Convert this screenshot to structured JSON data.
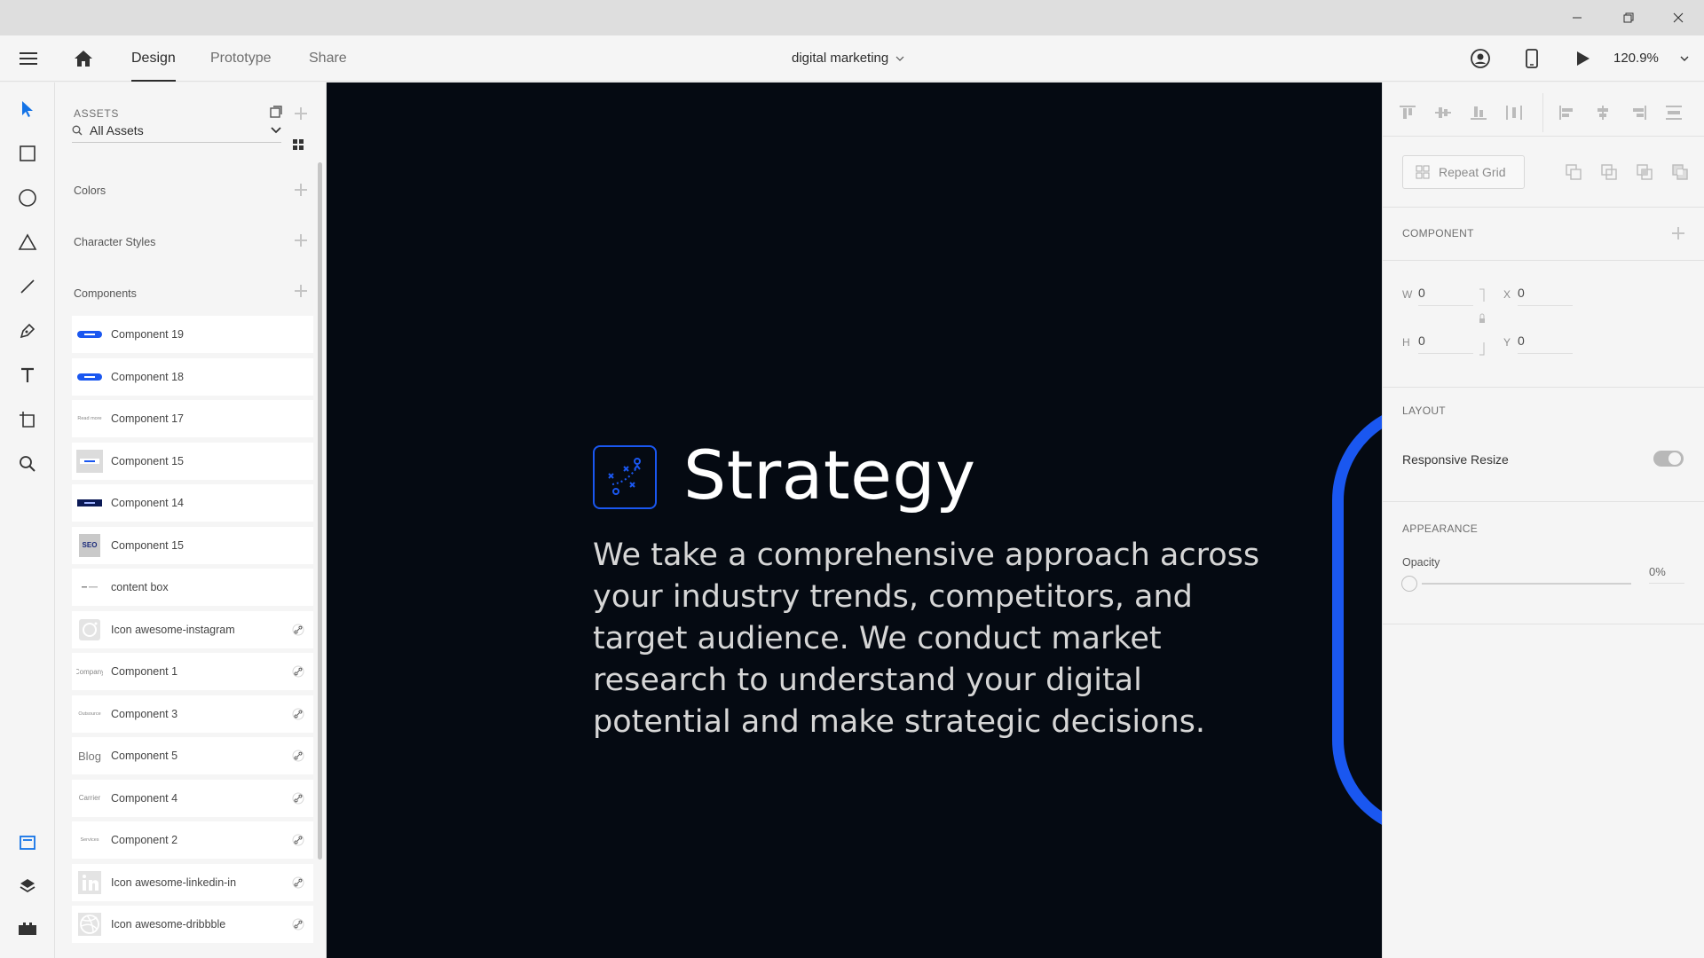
{
  "app": {
    "tabs": [
      {
        "label": "Design",
        "active": true
      },
      {
        "label": "Prototype",
        "active": false
      },
      {
        "label": "Share",
        "active": false
      }
    ],
    "document_title": "digital marketing",
    "zoom": "120.9%"
  },
  "toolbar": {
    "tools": [
      "select-tool",
      "rectangle-tool",
      "ellipse-tool",
      "polygon-tool",
      "line-tool",
      "pen-tool",
      "text-tool",
      "artboard-tool",
      "zoom-tool"
    ],
    "bottom": [
      "assets-panel",
      "layers-panel",
      "plugins-panel"
    ]
  },
  "assets": {
    "header": "ASSETS",
    "filter_value": "All Assets",
    "sections": {
      "colors": "Colors",
      "character_styles": "Character Styles",
      "components": "Components"
    },
    "components": [
      {
        "label": "Component 19",
        "thumb": "blue-pill",
        "linked": false
      },
      {
        "label": "Component 18",
        "thumb": "blue-pill",
        "linked": false
      },
      {
        "label": "Component 17",
        "thumb": "text-mini",
        "thumb_text": "Read more",
        "linked": false
      },
      {
        "label": "Component 15",
        "thumb": "gray-box",
        "linked": false
      },
      {
        "label": "Component 14",
        "thumb": "navy-bar",
        "linked": false
      },
      {
        "label": "Component 15",
        "thumb": "seo",
        "thumb_text": "SEO",
        "linked": false
      },
      {
        "label": "content box",
        "thumb": "tiny-line",
        "linked": false
      },
      {
        "label": "Icon awesome-instagram",
        "thumb": "instagram",
        "linked": true
      },
      {
        "label": "Component 1",
        "thumb": "text-mini",
        "thumb_text": "Company",
        "linked": true
      },
      {
        "label": "Component 3",
        "thumb": "text-mini",
        "thumb_text": "Outsource",
        "linked": true
      },
      {
        "label": "Component 5",
        "thumb": "text-big",
        "thumb_text": "Blog",
        "linked": true
      },
      {
        "label": "Component 4",
        "thumb": "text-mini",
        "thumb_text": "Carrier",
        "linked": true
      },
      {
        "label": "Component 2",
        "thumb": "text-mini",
        "thumb_text": "Services",
        "linked": true
      },
      {
        "label": "Icon awesome-linkedin-in",
        "thumb": "linkedin",
        "linked": true
      },
      {
        "label": "Icon awesome-dribbble",
        "thumb": "dribbble",
        "linked": true
      }
    ]
  },
  "canvas": {
    "title": "Strategy",
    "body": "We take a comprehensive approach across your industry trends, competitors, and target audience. We conduct market research to understand your digital potential and make strategic decisions.",
    "accent": "#1a57f0",
    "background": "#050a12"
  },
  "properties": {
    "repeat_grid_label": "Repeat Grid",
    "component_header": "COMPONENT",
    "w_label": "W",
    "w_value": "0",
    "h_label": "H",
    "h_value": "0",
    "x_label": "X",
    "x_value": "0",
    "y_label": "Y",
    "y_value": "0",
    "layout_header": "LAYOUT",
    "responsive_resize_label": "Responsive Resize",
    "responsive_resize_on": false,
    "appearance_header": "APPEARANCE",
    "opacity_label": "Opacity",
    "opacity_value": "0%"
  }
}
